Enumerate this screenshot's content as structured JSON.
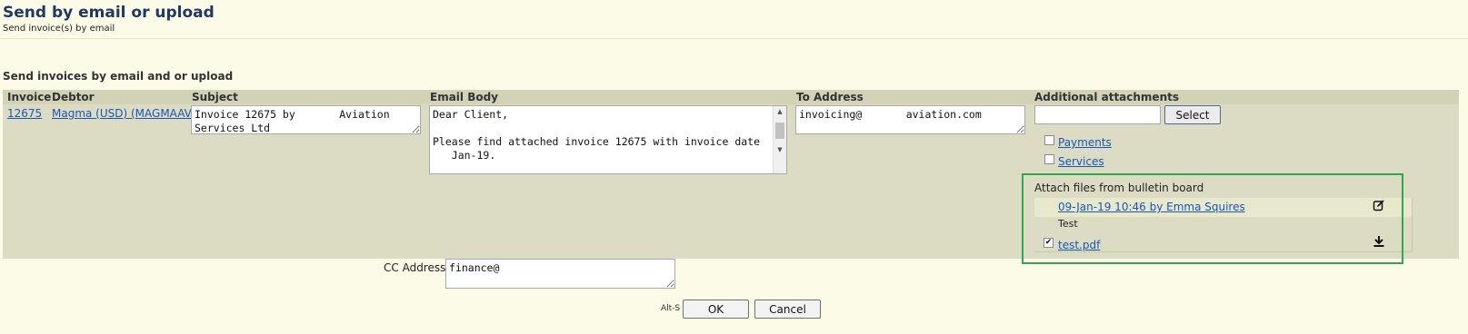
{
  "page": {
    "title": "Send by email or upload",
    "subtitle": "Send invoice(s) by email",
    "section_title": "Send invoices by email and or upload"
  },
  "table": {
    "headers": {
      "invoice": "Invoice",
      "debtor": "Debtor",
      "subject": "Subject",
      "email_body": "Email Body",
      "to_address": "To Address",
      "additional_attachments": "Additional attachments"
    },
    "row": {
      "invoice": "12675",
      "debtor": "Magma (USD) (MAGMAAVI)",
      "subject": "Invoice 12675 by       Aviation\nServices Ltd",
      "email_body": "Dear Client,\n\nPlease find attached invoice 12675 with invoice date\n   Jan-19.",
      "to_address": "invoicing@       aviation.com"
    }
  },
  "attachments": {
    "file_input_value": "",
    "select_label": "Select",
    "options": [
      {
        "label": "Payments",
        "checked": false
      },
      {
        "label": "Services",
        "checked": false
      }
    ]
  },
  "bulletin_board": {
    "title": "Attach files from bulletin board",
    "post_link": "09-Jan-19 10:46 by Emma Squires",
    "post_text": "Test",
    "file_name": "test.pdf",
    "file_checked": true,
    "edit_icon": "edit-icon",
    "download_icon": "download-icon"
  },
  "cc": {
    "label": "CC Address:",
    "value": "finance@"
  },
  "footer": {
    "hotkey_hint": "Alt-S",
    "ok_label": "OK",
    "cancel_label": "Cancel"
  }
}
